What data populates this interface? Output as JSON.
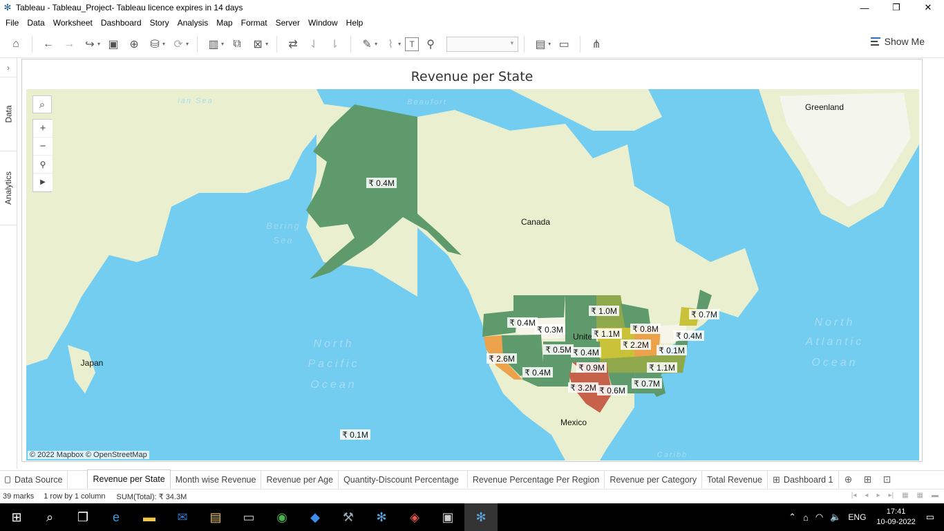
{
  "window": {
    "title": "Tableau - Tableau_Project- Tableau licence expires in 14 days"
  },
  "menu": [
    "File",
    "Data",
    "Worksheet",
    "Dashboard",
    "Story",
    "Analysis",
    "Map",
    "Format",
    "Server",
    "Window",
    "Help"
  ],
  "toolbar": {
    "show_me_label": "Show Me"
  },
  "side_panel": {
    "data_tab": "Data",
    "analytics_tab": "Analytics"
  },
  "viz": {
    "title": "Revenue per State",
    "attribution": "© 2022 Mapbox © OpenStreetMap"
  },
  "map_labels": {
    "greenland": "Greenland",
    "canada": "Canada",
    "mexico": "Mexico",
    "japan": "Japan",
    "united_states_partial": "Unite",
    "bering_sea_1": "Bering",
    "bering_sea_2": "Sea",
    "north_pacific_1": "North",
    "north_pacific_2": "Pacific",
    "north_pacific_3": "Ocean",
    "north_atlantic_1": "North",
    "north_atlantic_2": "Atlantic",
    "north_atlantic_3": "Ocean",
    "beaufort": "Beaufort",
    "arctic_sea": "ian Sea",
    "caribbean": "Caribb"
  },
  "colors": {
    "water": "#73cdf0",
    "land": "#eaf0cf",
    "greenland_ice": "#f4f6ee",
    "high": "#c8614a",
    "mid_high": "#eca24a",
    "mid": "#c9c238",
    "mid_low": "#8fa84c",
    "low": "#5f9a6d",
    "no_data": "#f7f5ea"
  },
  "chart_data": {
    "type": "map",
    "measure": "SUM(Total)",
    "states": [
      {
        "label": "₹ 0.4M",
        "region": "Alaska"
      },
      {
        "label": "₹ 0.4M",
        "region": "Washington/Oregon"
      },
      {
        "label": "₹ 0.3M",
        "region": "Montana"
      },
      {
        "label": "₹ 1.0M",
        "region": "Minnesota"
      },
      {
        "label": "₹ 0.8M",
        "region": "Michigan"
      },
      {
        "label": "₹ 0.7M",
        "region": "Maine"
      },
      {
        "label": "₹ 1.1M",
        "region": "Illinois"
      },
      {
        "label": "₹ 2.2M",
        "region": "Ohio"
      },
      {
        "label": "₹ 0.4M",
        "region": "New York"
      },
      {
        "label": "₹ 0.1M",
        "region": "New Jersey"
      },
      {
        "label": "₹ 2.6M",
        "region": "California"
      },
      {
        "label": "₹ 0.5M",
        "region": "Colorado"
      },
      {
        "label": "₹ 0.4M",
        "region": "Kansas"
      },
      {
        "label": "₹ 0.9M",
        "region": "Oklahoma"
      },
      {
        "label": "₹ 1.1M",
        "region": "Virginia/North Carolina"
      },
      {
        "label": "₹ 0.4M",
        "region": "Arizona"
      },
      {
        "label": "₹ 3.2M",
        "region": "Texas"
      },
      {
        "label": "₹ 0.6M",
        "region": "Louisiana"
      },
      {
        "label": "₹ 0.7M",
        "region": "Georgia"
      },
      {
        "label": "₹ 0.1M",
        "region": "Hawaii"
      }
    ]
  },
  "sheet_tabs": [
    {
      "label": "Data Source",
      "icon": "datasource-icon"
    },
    {
      "label": "Revenue per State",
      "active": true
    },
    {
      "label": "Month wise Revenue"
    },
    {
      "label": "Revenue per Age"
    },
    {
      "label": "Quantity-Discount Percentage"
    },
    {
      "label": "Revenue Percentage Per Region"
    },
    {
      "label": "Revenue per Category"
    },
    {
      "label": "Total Revenue"
    },
    {
      "label": "Dashboard 1",
      "icon": "dashboard-icon"
    }
  ],
  "status": {
    "marks": "39 marks",
    "rows_cols": "1 row by 1 column",
    "sum": "SUM(Total): ₹ 34.3M"
  },
  "taskbar": {
    "lang": "ENG",
    "time": "17:41",
    "date": "10-09-2022"
  }
}
